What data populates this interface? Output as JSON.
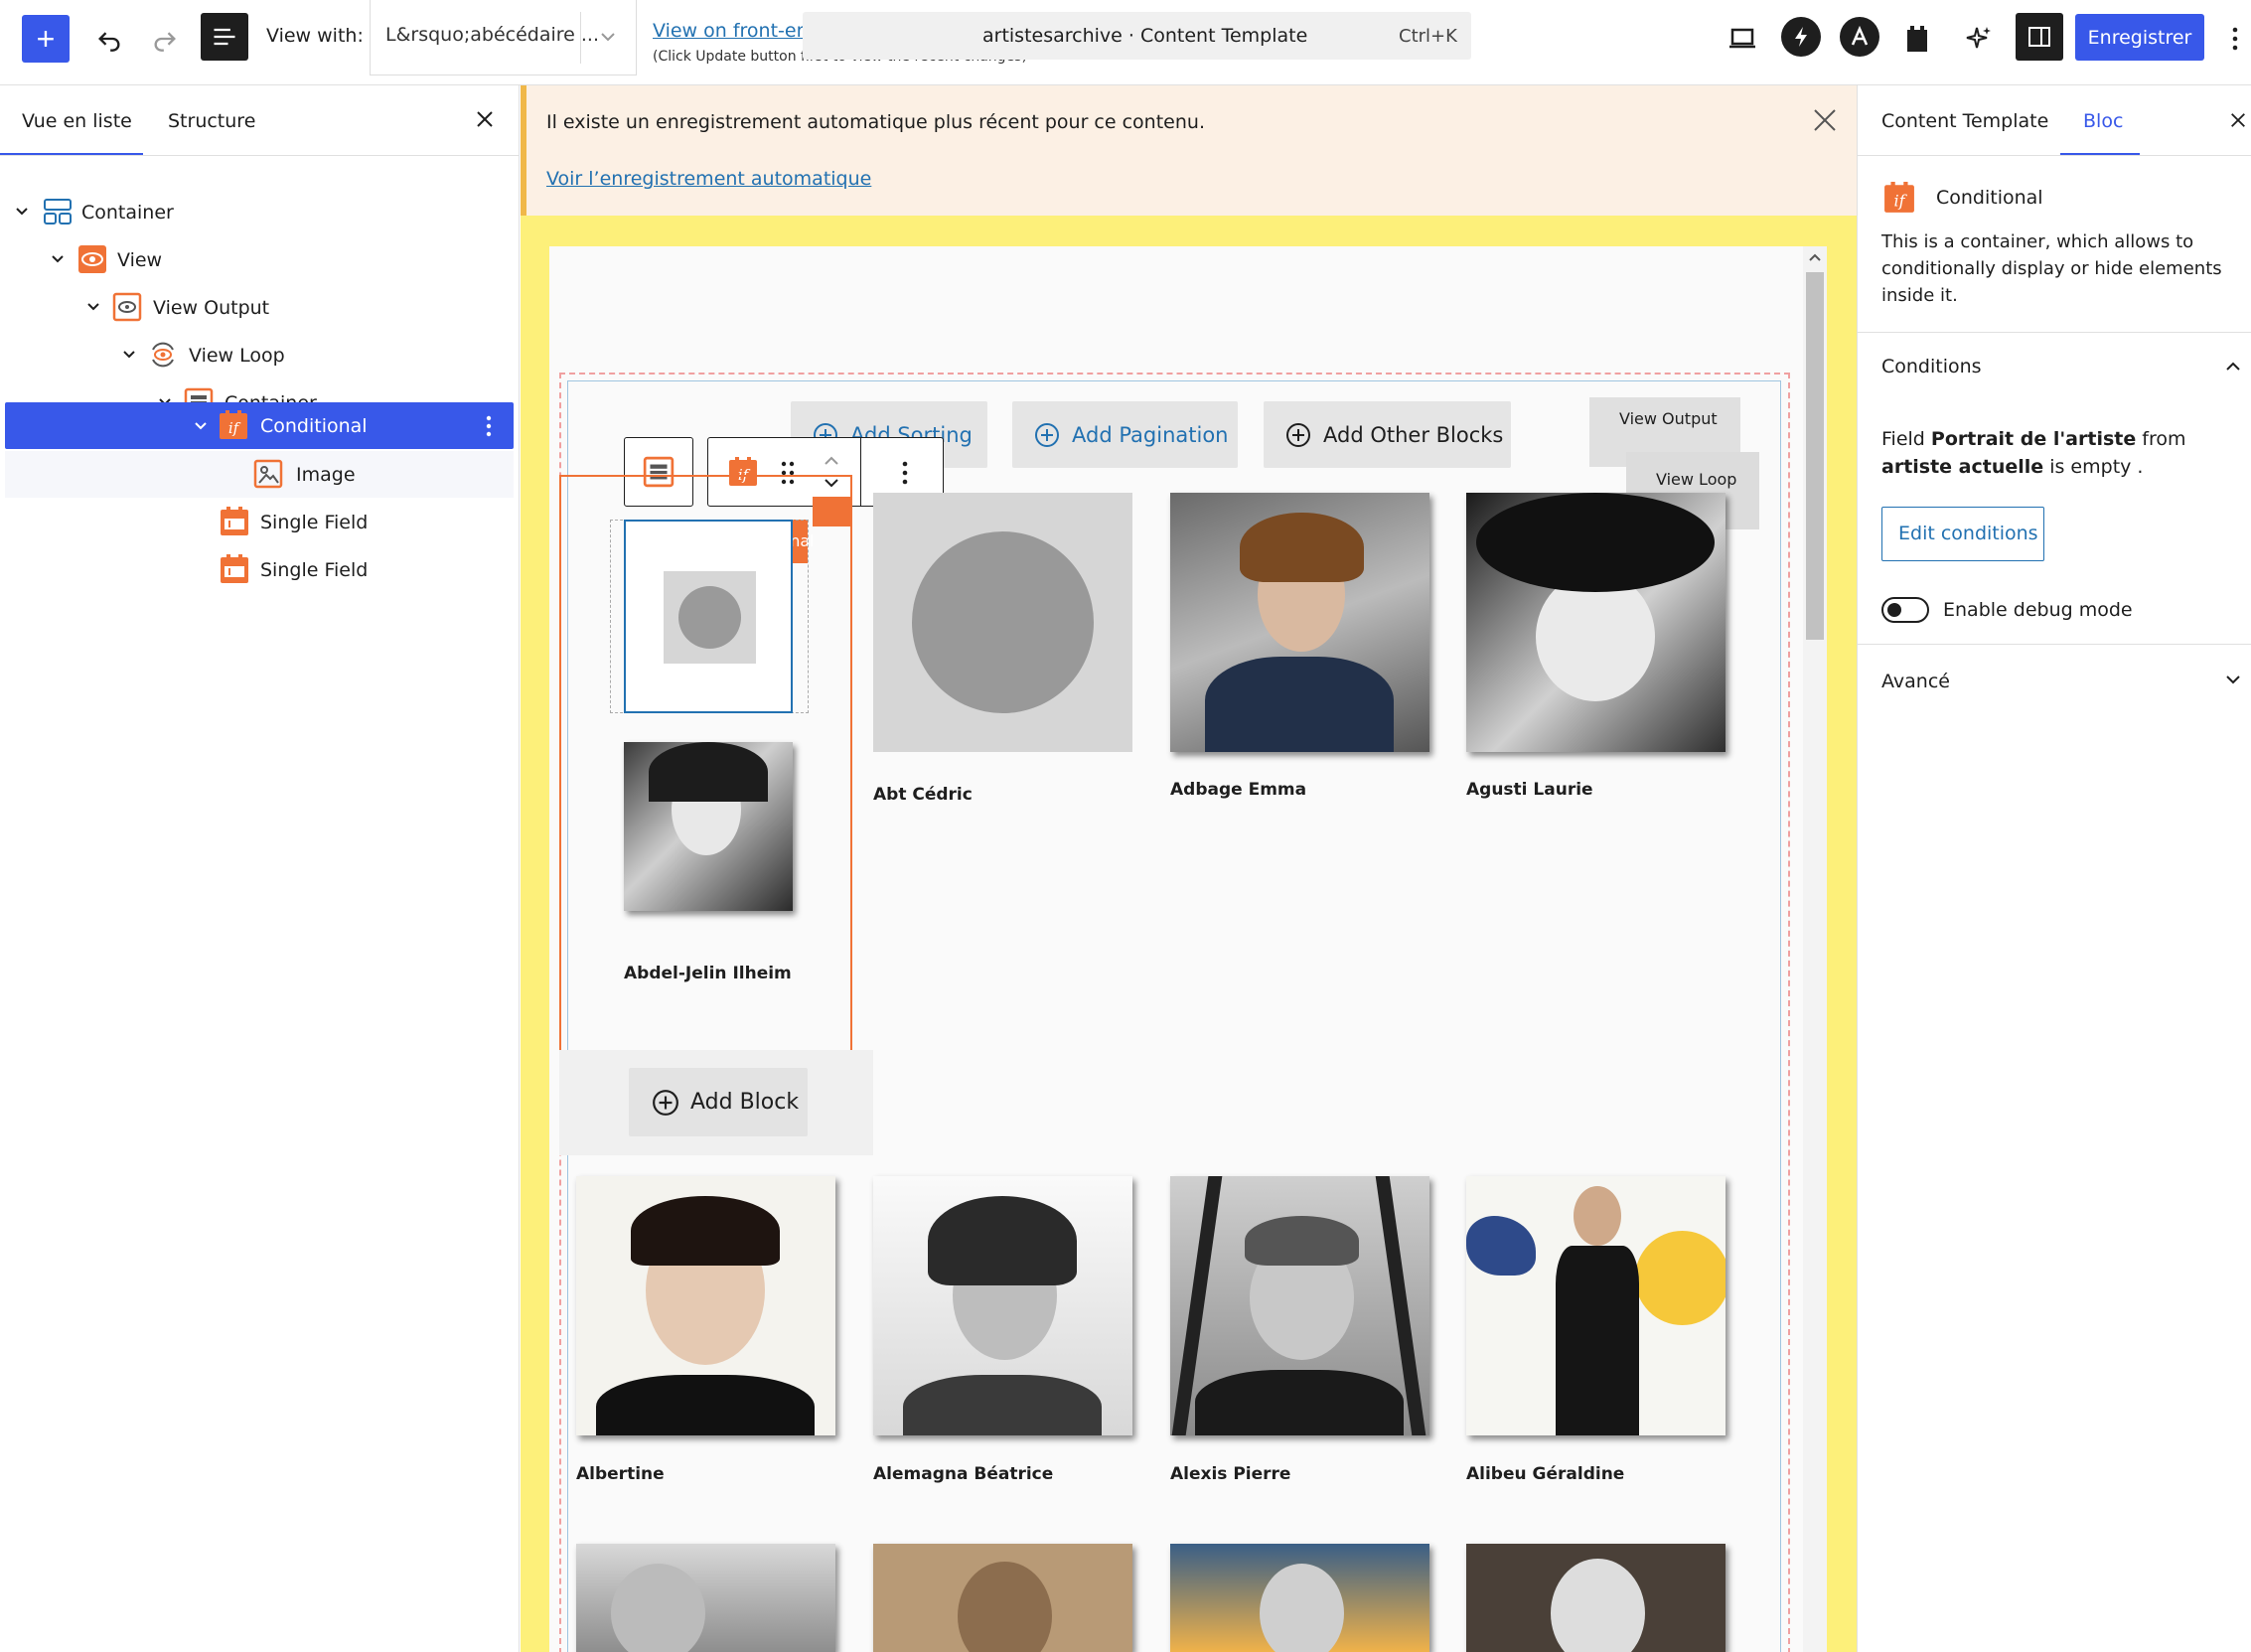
{
  "topbar": {
    "add_label": "+",
    "view_with_label": "View with:",
    "view_with_value": "L&rsquo;abécédaire ...",
    "view_front_link": "View on front-end",
    "update_hint": "(Click Update button first to view the recent changes)",
    "doc_title": "artistesarchive · Content Template",
    "shortcut": "Ctrl+K",
    "save_label": "Enregistrer"
  },
  "left_panel": {
    "tabs": [
      "Vue en liste",
      "Structure"
    ],
    "tree": [
      {
        "label": "Container"
      },
      {
        "label": "View"
      },
      {
        "label": "View Output"
      },
      {
        "label": "View Loop"
      },
      {
        "label": "Container"
      },
      {
        "label": "Conditional"
      },
      {
        "label": "Image"
      },
      {
        "label": "Single Field"
      },
      {
        "label": "Single Field"
      }
    ]
  },
  "notice": {
    "text": "Il existe un enregistrement automatique plus récent pour ce contenu.",
    "link": "Voir l’enregistrement automatique"
  },
  "canvas": {
    "add_sorting": "Add Sorting",
    "add_pagination": "Add Pagination",
    "add_other_blocks": "Add Other Blocks",
    "view_output_badge": "View Output",
    "view_loop_badge": "View Loop",
    "conditional_tag": "Conditional",
    "add_block": "Add Block",
    "artists": [
      "Abdel-Jelin Ilheim",
      "Abt Cédric",
      "Adbage Emma",
      "Agusti Laurie",
      "Albertine",
      "Alemagna Béatrice",
      "Alexis Pierre",
      "Alibeu Géraldine"
    ]
  },
  "right_panel": {
    "tabs": [
      "Content Template",
      "Bloc"
    ],
    "block_name": "Conditional",
    "block_desc": "This is a container, which allows to conditionally display or hide elements inside it.",
    "conditions_title": "Conditions",
    "cond_prefix": "Field",
    "cond_field": "Portrait de l'artiste",
    "cond_mid": "from",
    "cond_source": "artiste actuelle",
    "cond_suffix": "is empty .",
    "edit_conditions": "Edit conditions",
    "debug_label": "Enable debug mode",
    "advanced": "Avancé"
  },
  "colors": {
    "accent": "#3858e9",
    "toolset_orange": "#f07236",
    "canvas_yellow": "#fdf07a"
  }
}
